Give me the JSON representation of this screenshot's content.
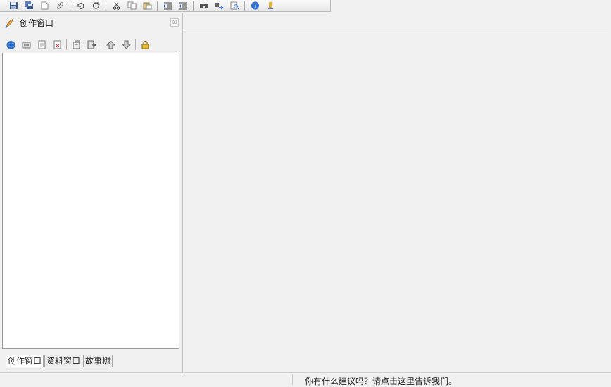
{
  "toolbar": {
    "icons": [
      "save-icon",
      "save-all-icon",
      "new-document-icon",
      "attach-icon",
      "undo-icon",
      "redo-icon",
      "cut-icon",
      "copy-icon",
      "paste-icon",
      "indent-icon",
      "outdent-icon",
      "find-icon",
      "replace-icon",
      "print-preview-icon",
      "help-icon",
      "about-icon"
    ]
  },
  "left_pane": {
    "title": "创作窗口",
    "close_glyph": "☒",
    "toolbar_icons": [
      "add-book-icon",
      "new-folder-icon",
      "new-chapter-icon",
      "delete-icon",
      "properties-icon",
      "export-icon",
      "move-up-icon",
      "move-down-icon",
      "lock-icon"
    ],
    "tabs": [
      {
        "label": "创作窗口",
        "active": true
      },
      {
        "label": "资料窗口",
        "active": false
      },
      {
        "label": "故事树",
        "active": false
      }
    ]
  },
  "statusbar": {
    "message": "你有什么建议吗？请点击这里告诉我们。"
  },
  "colors": {
    "background": "#f0f0f0",
    "panel_white": "#ffffff",
    "border": "#9a9a9a"
  }
}
